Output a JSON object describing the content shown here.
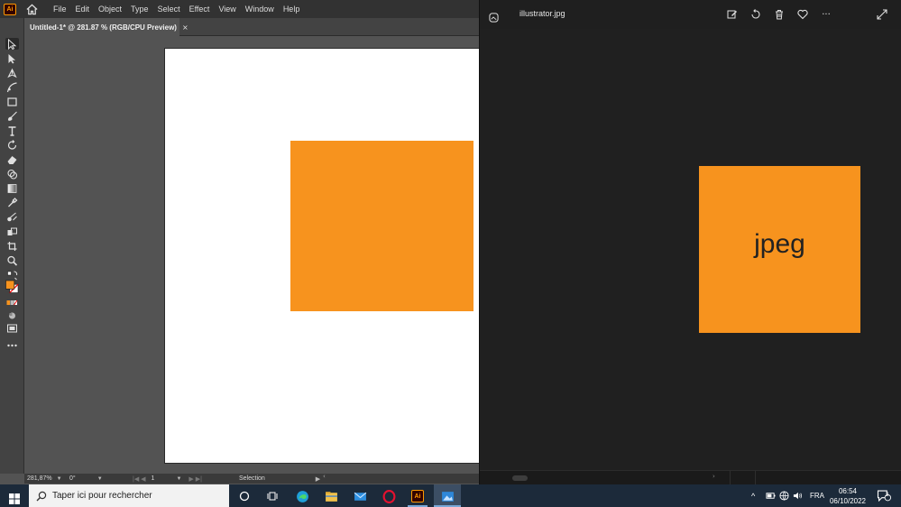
{
  "illustrator": {
    "logo": "Ai",
    "menu": [
      "File",
      "Edit",
      "Object",
      "Type",
      "Select",
      "Effect",
      "View",
      "Window",
      "Help"
    ],
    "doc_tab": {
      "title": "Untitled-1* @ 281.87 % (RGB/CPU Preview)",
      "close": "×"
    },
    "rect_color": "#f7931e",
    "status": {
      "zoom": "281,87%",
      "rotation": "0°",
      "page": "1",
      "mode": "Selection"
    }
  },
  "viewer": {
    "title": "illustrator.jpg",
    "image_text": "jpeg",
    "more": "···"
  },
  "taskbar": {
    "search_placeholder": "Taper ici pour rechercher",
    "ai_label": "Ai",
    "language": "FRA",
    "time": "06:54",
    "date": "06/10/2022",
    "notifications": "2"
  },
  "colors": {
    "accent_orange": "#f7931e",
    "taskbar": "#1c2a3a"
  }
}
